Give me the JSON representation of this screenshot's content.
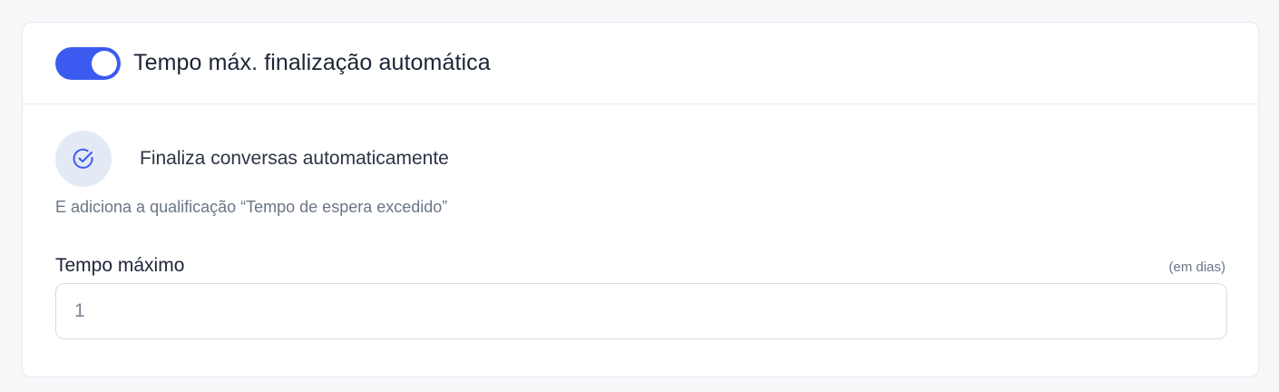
{
  "header": {
    "toggle_on": true,
    "title": "Tempo máx. finalização automática"
  },
  "info": {
    "icon": "check-circle-icon",
    "title": "Finaliza conversas automaticamente",
    "subtitle": "E adiciona a qualificação “Tempo de espera excedido”"
  },
  "field": {
    "label": "Tempo máximo",
    "unit": "(em dias)",
    "value": "1"
  },
  "colors": {
    "accent": "#3b5bf0",
    "icon_bg": "#e4e9f6",
    "text_primary": "#1c2536",
    "text_muted": "#6b7685"
  }
}
